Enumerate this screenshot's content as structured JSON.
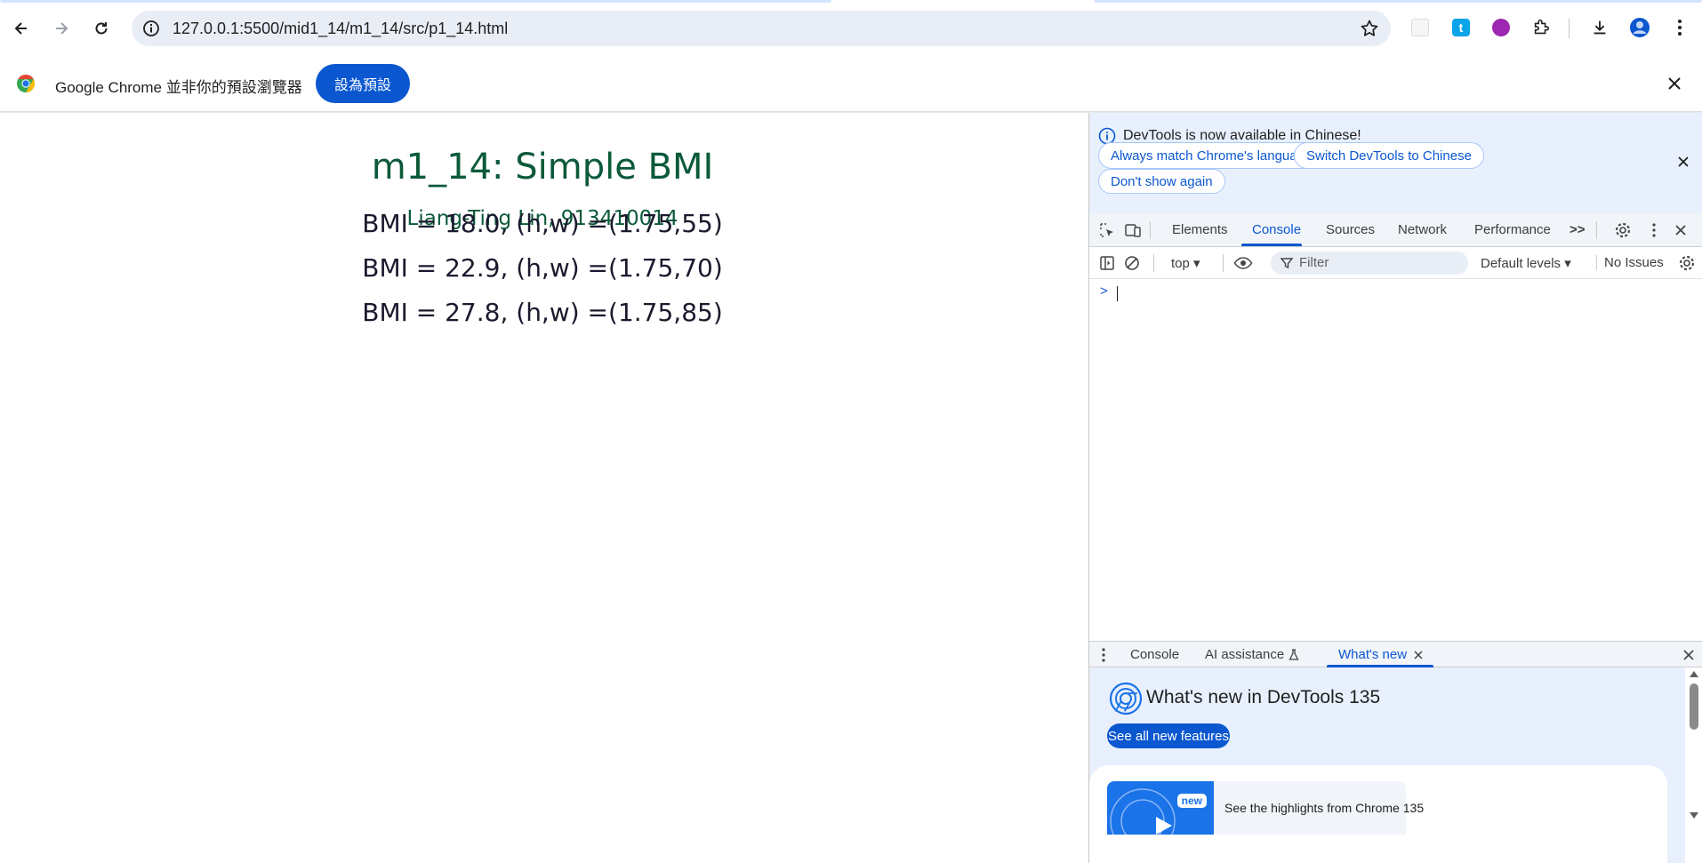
{
  "toolbar": {
    "url": "127.0.0.1:5500/mid1_14/m1_14/src/p1_14.html",
    "icons": [
      "back-icon",
      "forward-icon",
      "reload-icon",
      "site-info-icon",
      "bookmark-star-icon",
      "extension-icon",
      "puzzle-icon",
      "download-icon",
      "profile-icon",
      "menu-icon"
    ]
  },
  "infobar": {
    "message": "Google Chrome 並非你的預設瀏覽器",
    "button": "設為預設"
  },
  "page": {
    "title": "m1_14: Simple BMI",
    "author": "Liang-Ting Lin, 913410014",
    "results": [
      "BMI = 18.0, (h,w) =(1.75,55)",
      "BMI = 22.9, (h,w) =(1.75,70)",
      "BMI = 27.8, (h,w) =(1.75,85)"
    ],
    "colors": {
      "title": "#0b5a3a",
      "text": "#1a1a2e"
    }
  },
  "devtools": {
    "banner": {
      "text": "DevTools is now available in Chinese!",
      "always_match": "Always match Chrome's language",
      "switch": "Switch DevTools to Chinese",
      "dont_show": "Don't show again"
    },
    "tabs": [
      "Elements",
      "Console",
      "Sources",
      "Network",
      "Performance"
    ],
    "active_tab": "Console",
    "more": ">>",
    "console_bar": {
      "context": "top ▾",
      "filter_placeholder": "Filter",
      "levels": "Default levels ▾",
      "issues": "No Issues"
    },
    "prompt": ">",
    "drawer": {
      "tabs": [
        "Console",
        "AI assistance",
        "What's new"
      ],
      "active_tab": "What's new",
      "whats_new_title": "What's new in DevTools 135",
      "see_all": "See all new features",
      "badge": "new",
      "highlight": "See the highlights from Chrome 135"
    }
  }
}
